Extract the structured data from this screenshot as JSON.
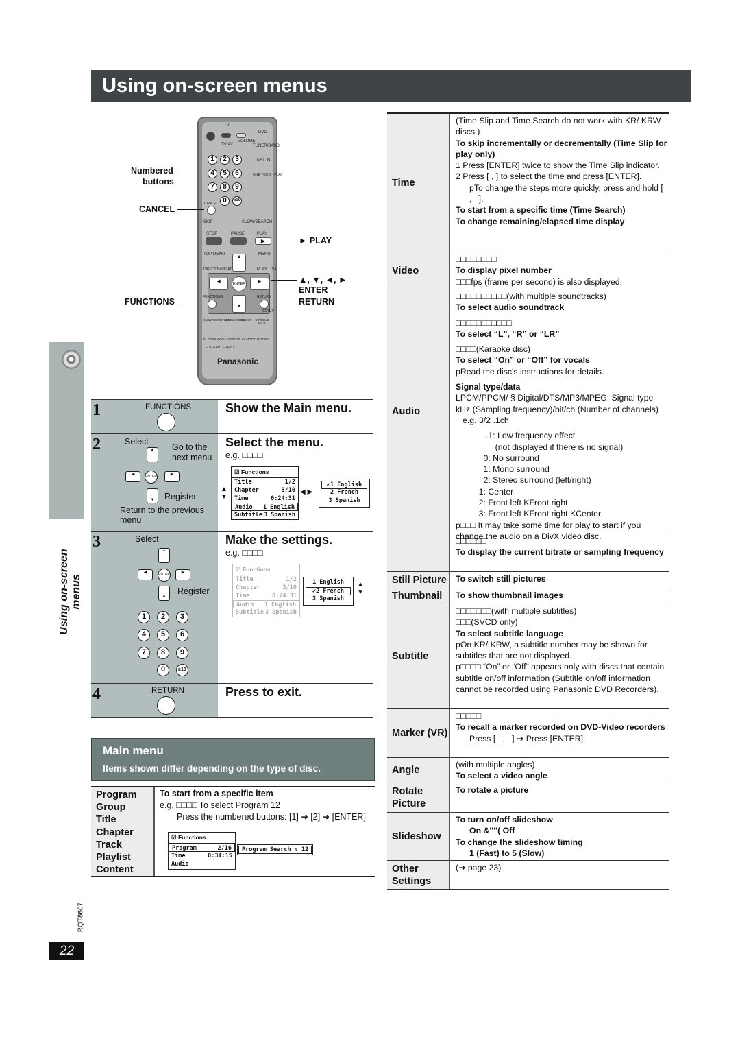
{
  "header": {
    "title": "Using on-screen menus"
  },
  "side": {
    "vertical_title": "Using on-screen menus",
    "doc_code": "RQT8607",
    "page_number": "22"
  },
  "remote": {
    "labels": {
      "tv": "TV",
      "dvd": "DVD",
      "volume": "VOLUME",
      "tvav": "TV/AV",
      "tuner": "TUNER/BAND",
      "extin": "EXT-IN",
      "onetouch": "ONE TOUCH PLAY",
      "cancel": "CANCEL",
      "skip": "SKIP",
      "slow": "SLOW/SEARCH",
      "stop": "STOP",
      "pause": "PAUSE",
      "play": "PLAY",
      "topmenu": "TOP MENU",
      "menu": "MENU",
      "direct": "DIRECT NAVIGATOR",
      "playlist": "PLAY LIST",
      "enter": "ENTER",
      "functions": "FUNCTIONS",
      "return": "RETURN",
      "setup": "– SETUP",
      "subwoofer": "SUBWOOFER LEVEL",
      "sfc": "– SFC – SRD ENH",
      "hbass": "– H.BASS – C.FOCUS",
      "dplii": "PL II",
      "fldisplay": "FL DISPLAY",
      "chselect": "CH SELECT",
      "playmode": "PLAY MODE",
      "muting": "MUTING",
      "sleep": "– SLEEP",
      "test": "– TEST",
      "brand": "Panasonic"
    },
    "digits": [
      "1",
      "2",
      "3",
      "4",
      "5",
      "6",
      "7",
      "8",
      "9",
      "0",
      "≥10"
    ]
  },
  "callouts": {
    "numbered": "Numbered",
    "buttons": "buttons",
    "cancel": "CANCEL",
    "functions": "FUNCTIONS",
    "play": "► PLAY",
    "arrows": "▲, ▼, ◄, ►",
    "enter": "ENTER",
    "return": "RETURN"
  },
  "steps": [
    {
      "num": "1",
      "button": "FUNCTIONS",
      "heading": "Show the Main menu."
    },
    {
      "num": "2",
      "select": "Select",
      "go_next": "Go to the next menu",
      "register": "Register",
      "return_prev": "Return to the previous menu",
      "heading": "Select the menu.",
      "eg": "e.g. □□□□"
    },
    {
      "num": "3",
      "select": "Select",
      "register": "Register",
      "heading": "Make the settings.",
      "eg": "e.g. □□□□"
    },
    {
      "num": "4",
      "button": "RETURN",
      "heading": "Press to exit."
    }
  ],
  "osd": {
    "title": "Functions",
    "rows": [
      [
        "Title",
        "1/2"
      ],
      [
        "Chapter",
        "3/10"
      ],
      [
        "Time",
        "0:24:31"
      ],
      [
        "Audio",
        "1 English"
      ],
      [
        "Subtitle",
        "3 Spanish"
      ]
    ],
    "options": [
      "1 English",
      "2 French",
      "3 Spanish"
    ],
    "selected_step2": "1 English",
    "selected_step3": "2 French",
    "prog_rows": [
      [
        "Program",
        "2/16"
      ],
      [
        "Time",
        "0:34:15"
      ],
      [
        "Audio",
        ""
      ]
    ],
    "prog_search": "Program Search ⇕ 12"
  },
  "main_menu": {
    "title": "Main menu",
    "subtitle": "Items shown differ depending on the type of disc.",
    "items": [
      "Program",
      "Group",
      "Title",
      "Chapter",
      "Track",
      "Playlist",
      "Content"
    ],
    "desc_title": "To start from a specific item",
    "desc_eg": "e.g. □□□□ To select Program 12",
    "desc_press": "Press the numbered buttons: [1] ➜ [2] ➜ [ENTER]"
  },
  "settings": [
    {
      "label": "Time",
      "h": 202,
      "lines": [
        {
          "t": "(Time Slip and Time Search do not work with KR/ KRW discs.)"
        },
        {
          "t": "To skip incrementally or decrementally (Time Slip for play only)",
          "bold": true
        },
        {
          "t": "1  Press [ENTER] twice to show the Time Slip indicator."
        },
        {
          "t": "2  Press [   ,   ] to select the time and press [ENTER]."
        },
        {
          "t": "pTo change the steps more quickly, press and hold [   ,   ].",
          "level": 1
        },
        {
          "t": "To start from a specific time (Time Search)",
          "bold": true
        },
        {
          "t": "To change remaining/elapsed time display",
          "bold": true
        }
      ]
    },
    {
      "label": "Video",
      "h": 54,
      "lines": [
        {
          "t": "□□□□□□□□"
        },
        {
          "t": "To display pixel number",
          "bold": true
        },
        {
          "t": "□□□fps (frame per second) is also displayed."
        }
      ]
    },
    {
      "label": "Audio",
      "h": 357,
      "lines": [
        {
          "t": "□□□□□□□□□□(with multiple soundtracks)"
        },
        {
          "t": "To select audio soundtrack",
          "bold": true
        },
        {
          "t": "□□□□□□□□□□□",
          "gap": true
        },
        {
          "t": "To select “L”, “R” or “LR”",
          "bold": true
        },
        {
          "t": "□□□□(Karaoke disc)",
          "gap": true
        },
        {
          "t": "To select “On” or “Off” for vocals",
          "bold": true
        },
        {
          "t": "pRead the disc's instructions for details."
        },
        {
          "t": "Signal type/data",
          "bold": true,
          "gap": true
        },
        {
          "t": "LPCM/PPCM/ § Digital/DTS/MP3/MPEG: Signal type"
        },
        {
          "t": "kHz (Sampling frequency)/bit/ch (Number of channels)"
        },
        {
          "t": "e.g. 3/2 .1ch",
          "level": 2
        },
        {
          "t": "       .1: Low frequency effect",
          "level": 1,
          "gap": true
        },
        {
          "t": "           (not displayed if there is no signal)",
          "level": 1
        },
        {
          "t": "      0: No surround",
          "level": 1
        },
        {
          "t": "      1: Mono surround",
          "level": 1
        },
        {
          "t": "      2: Stereo surround (left/right)",
          "level": 1
        },
        {
          "t": "    1: Center",
          "level": 1
        },
        {
          "t": "    2: Front left KFront right",
          "level": 1
        },
        {
          "t": "    3: Front left KFront right KCenter",
          "level": 1
        },
        {
          "t": "p□□□ It may take some time for play to start if you change the audio on a DivX video disc."
        }
      ]
    },
    {
      "label": "",
      "h": 55,
      "lines": [
        {
          "t": "□□□□□□"
        },
        {
          "t": "To display the current bitrate or sampling frequency",
          "bold": true
        }
      ]
    },
    {
      "label": "Still Picture",
      "h": 24,
      "lines": [
        {
          "t": "To switch still pictures",
          "bold": true
        }
      ]
    },
    {
      "label": "Thumbnail",
      "h": 23,
      "lines": [
        {
          "t": "To show thumbnail images",
          "bold": true
        }
      ]
    },
    {
      "label": "Subtitle",
      "h": 153,
      "lines": [
        {
          "t": "□□□□□□□(with multiple subtitles)"
        },
        {
          "t": "□□□(SVCD only)"
        },
        {
          "t": "To select subtitle language",
          "bold": true
        },
        {
          "t": "pOn KR/ KRW, a subtitle number may be shown for subtitles that are not displayed."
        },
        {
          "t": "p□□□□ “On” or “Off” appears only with discs that contain subtitle on/off information (Subtitle on/off information cannot be recorded using Panasonic DVD Recorders)."
        }
      ]
    },
    {
      "label": "Marker (VR)",
      "h": 71,
      "lines": [
        {
          "t": "□□□□□"
        },
        {
          "t": "To recall a marker recorded on DVD-Video recorders",
          "bold": true
        },
        {
          "t": "Press [   ,   ] ➜ Press [ENTER].",
          "level": 1
        }
      ]
    },
    {
      "label": "Angle",
      "h": 37,
      "lines": [
        {
          "t": "(with multiple angles)"
        },
        {
          "t": "To select a video angle",
          "bold": true
        }
      ]
    },
    {
      "label": "Rotate Picture",
      "h": 43,
      "top": true,
      "lines": [
        {
          "t": "To rotate a picture",
          "bold": true
        }
      ]
    },
    {
      "label": "Slideshow",
      "h": 70,
      "lines": [
        {
          "t": "To turn on/off slideshow",
          "bold": true
        },
        {
          "t": "On &''''( Off",
          "bold": true,
          "level": 1
        },
        {
          "t": "To change the slideshow timing",
          "bold": true
        },
        {
          "t": "1 (Fast) to 5 (Slow)",
          "bold": true,
          "level": 1
        }
      ]
    },
    {
      "label": "Other Settings",
      "h": 42,
      "top": true,
      "lines": [
        {
          "t": "(➜ page 23)"
        }
      ]
    }
  ],
  "colors": {
    "title_bar": "#3f4547",
    "step_panel": "#b1bebd",
    "main_menu_box": "#6e7f7d",
    "label_column": "#ececec"
  }
}
